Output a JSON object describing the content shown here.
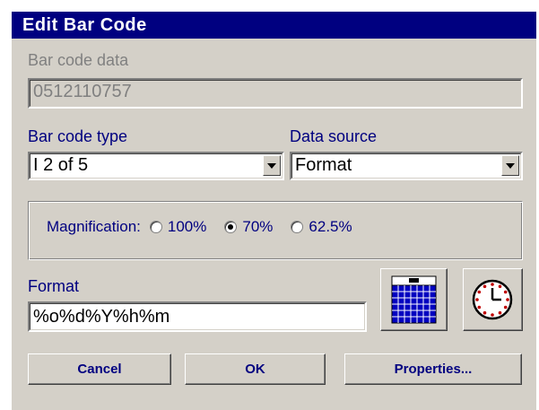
{
  "dialog": {
    "title": "Edit Bar Code"
  },
  "barcode_data": {
    "label": "Bar code data",
    "value": "0512110757"
  },
  "barcode_type": {
    "label": "Bar code type",
    "value": "I 2 of 5"
  },
  "data_source": {
    "label": "Data source",
    "value": "Format"
  },
  "magnification": {
    "label": "Magnification:",
    "options": [
      "100%",
      "70%",
      "62.5%"
    ],
    "selected": "70%"
  },
  "format": {
    "label": "Format",
    "value": "%o%d%Y%h%m"
  },
  "buttons": {
    "cancel": "Cancel",
    "ok": "OK",
    "properties": "Properties..."
  },
  "icons": {
    "calendar": "calendar-icon",
    "clock": "clock-icon"
  },
  "colors": {
    "titlebar": "#000080",
    "label_text": "#000080",
    "dialog_bg": "#d4d0c8"
  }
}
